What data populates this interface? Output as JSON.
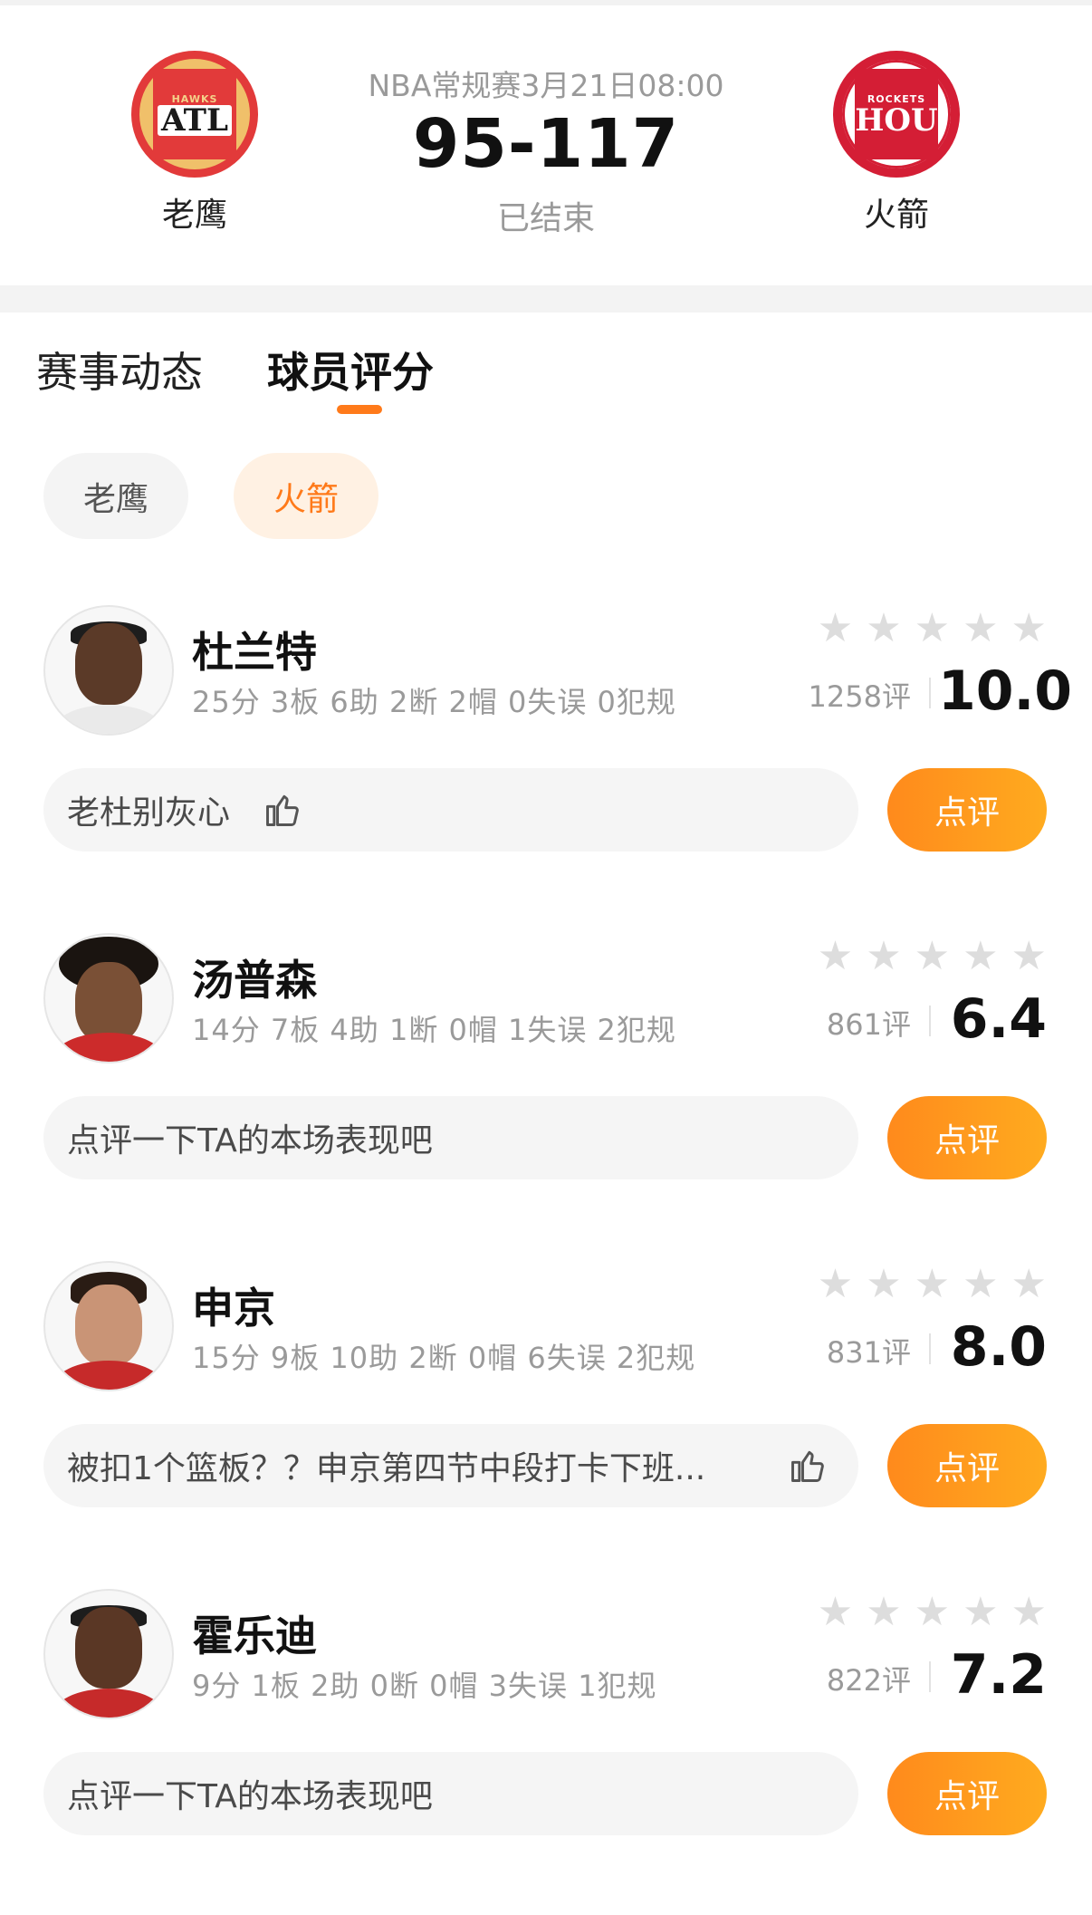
{
  "match": {
    "league_time": "NBA常规赛3月21日08:00",
    "score": "95-117",
    "status": "已结束",
    "home": {
      "name": "老鹰",
      "logo_top": "HAWKS",
      "logo_main": "ATL"
    },
    "away": {
      "name": "火箭",
      "logo_top": "ROCKETS",
      "logo_main": "HOU"
    }
  },
  "tabs": [
    {
      "label": "赛事动态",
      "active": false
    },
    {
      "label": "球员评分",
      "active": true
    }
  ],
  "team_filters": [
    {
      "label": "老鹰",
      "active": false
    },
    {
      "label": "火箭",
      "active": true
    }
  ],
  "players": [
    {
      "name": "杜兰特",
      "stats": "25分 3板 6助 2断 2帽 0失误 0犯规",
      "reviews": "1258评",
      "rating": "10.0",
      "comment": "老杜别灰心",
      "liked_icon": "thumbs-up-icon",
      "button": "点评"
    },
    {
      "name": "汤普森",
      "stats": "14分 7板 4助 1断 0帽 1失误 2犯规",
      "reviews": "861评",
      "rating": "6.4",
      "comment": "点评一下TA的本场表现吧",
      "button": "点评"
    },
    {
      "name": "申京",
      "stats": "15分 9板 10助 2断 0帽 6失误 2犯规",
      "reviews": "831评",
      "rating": "8.0",
      "comment": "被扣1个篮板？？申京第四节中段打卡下班...",
      "liked_icon": "thumbs-up-icon",
      "button": "点评"
    },
    {
      "name": "霍乐迪",
      "stats": "9分 1板 2助 0断 0帽 3失误 1犯规",
      "reviews": "822评",
      "rating": "7.2",
      "comment": "点评一下TA的本场表现吧",
      "button": "点评"
    }
  ],
  "colors": {
    "accent": "#ff7a1a",
    "hawks": "#e23a3a",
    "rockets": "#d41e35"
  }
}
